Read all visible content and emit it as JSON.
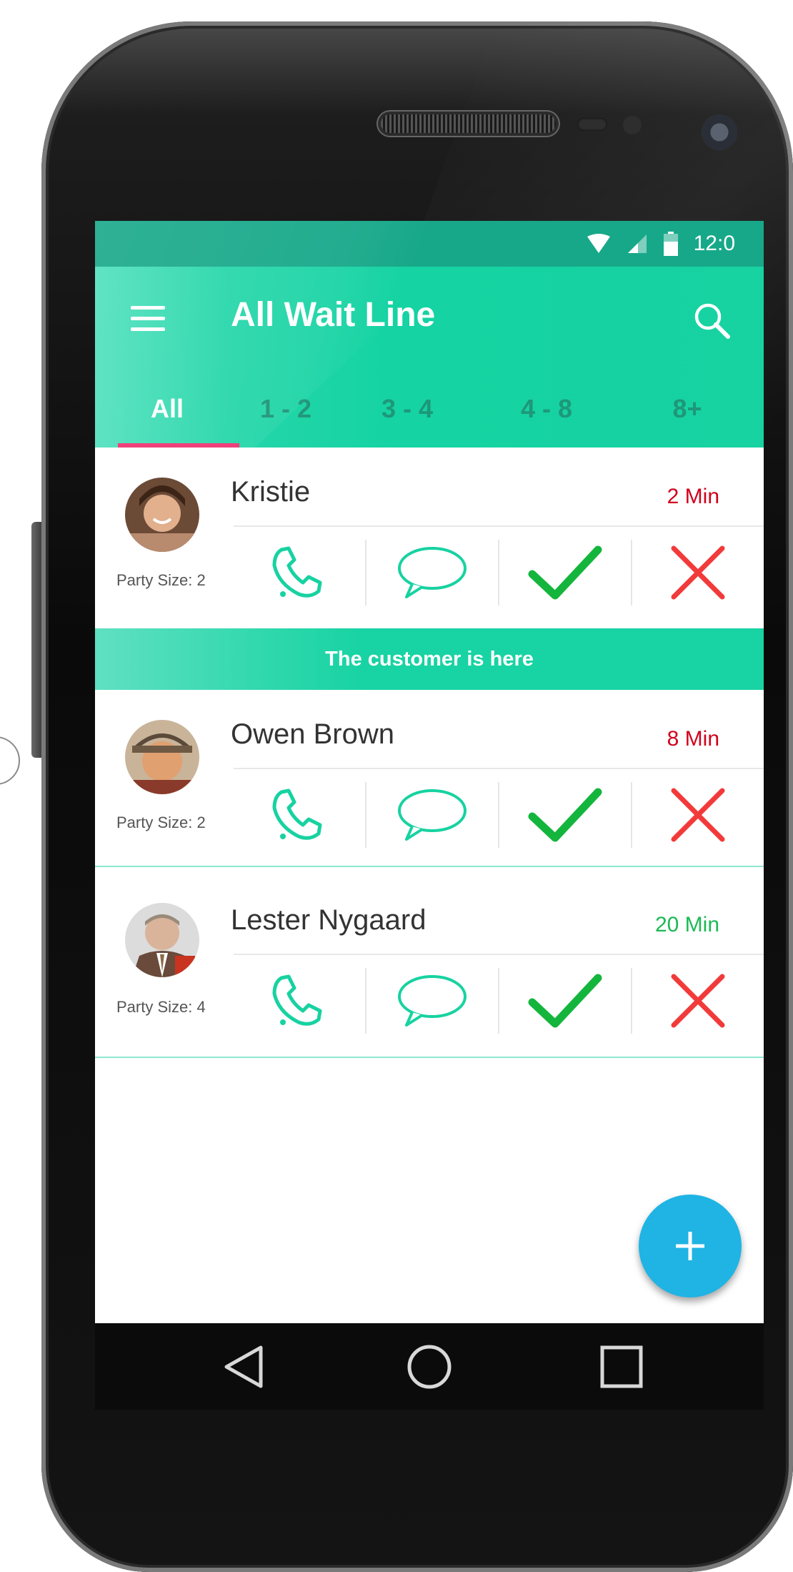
{
  "status_bar": {
    "time": "12:0"
  },
  "app_bar": {
    "title": "All Wait Line",
    "menu_icon": "hamburger-menu-icon",
    "search_icon": "search-icon"
  },
  "tabs": [
    {
      "label": "All",
      "active": true
    },
    {
      "label": "1 - 2",
      "active": false
    },
    {
      "label": "3 - 4",
      "active": false
    },
    {
      "label": "4 - 8",
      "active": false
    },
    {
      "label": "8+",
      "active": false
    }
  ],
  "customers": [
    {
      "name": "Kristie",
      "party_size": "Party Size: 2",
      "wait": "2 Min",
      "wait_color": "#d0021b"
    },
    {
      "name": "Owen Brown",
      "party_size": "Party Size: 2",
      "wait": "8 Min",
      "wait_color": "#d0021b"
    },
    {
      "name": "Lester Nygaard",
      "party_size": "Party Size: 4",
      "wait": "20 Min",
      "wait_color": "#1db954"
    }
  ],
  "banner": {
    "text": "The customer is here"
  },
  "colors": {
    "accent": "#17d2a1",
    "status_bar": "#17a889",
    "tab_indicator": "#f0417a",
    "fab": "#1fb4e4",
    "check": "#14b53c",
    "cross": "#f23a3a"
  },
  "icons": {
    "call": "phone-icon",
    "message": "chat-bubble-icon",
    "confirm": "check-icon",
    "remove": "close-icon",
    "fab": "plus-icon"
  }
}
